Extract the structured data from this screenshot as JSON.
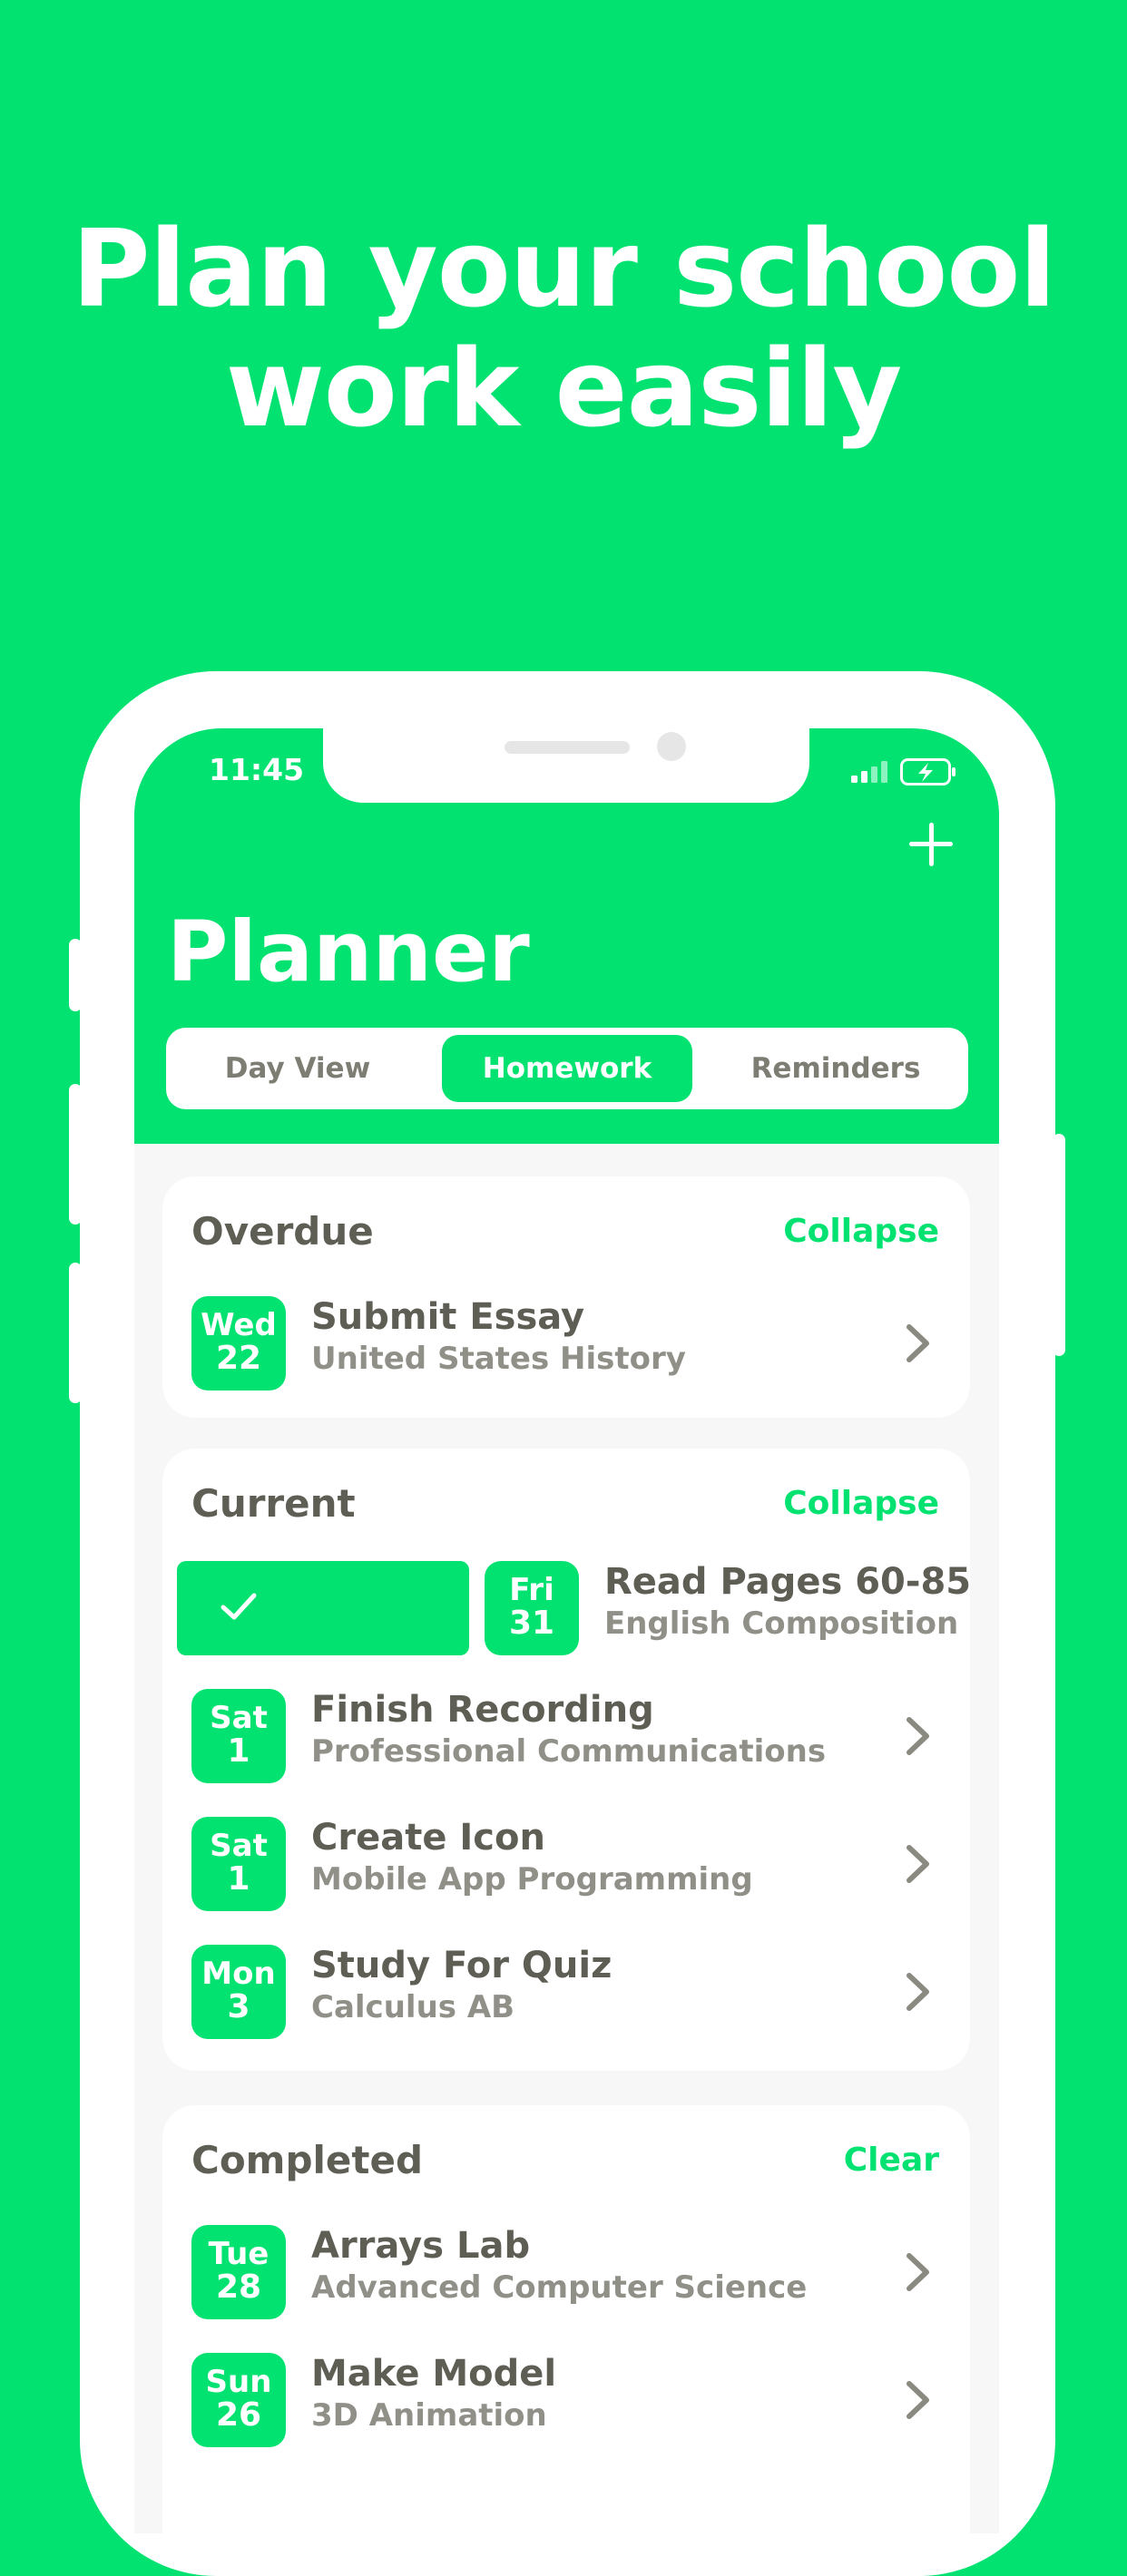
{
  "headline": {
    "line1": "Plan your school",
    "line2": "work easily"
  },
  "status_bar": {
    "time": "11:45"
  },
  "header": {
    "title": "Planner"
  },
  "tabs": [
    {
      "label": "Day View",
      "active": false
    },
    {
      "label": "Homework",
      "active": true
    },
    {
      "label": "Reminders",
      "active": false
    }
  ],
  "sections": {
    "overdue": {
      "title": "Overdue",
      "action": "Collapse",
      "items": [
        {
          "dow": "Wed",
          "day": "22",
          "title": "Submit Essay",
          "subtitle": "United States History"
        }
      ]
    },
    "current": {
      "title": "Current",
      "action": "Collapse",
      "items": [
        {
          "dow": "Fri",
          "day": "31",
          "title": "Read Pages 60-85",
          "subtitle": "English Composition"
        },
        {
          "dow": "Sat",
          "day": "1",
          "title": "Finish Recording",
          "subtitle": "Professional Communications"
        },
        {
          "dow": "Sat",
          "day": "1",
          "title": "Create Icon",
          "subtitle": "Mobile App Programming"
        },
        {
          "dow": "Mon",
          "day": "3",
          "title": "Study For Quiz",
          "subtitle": "Calculus AB"
        }
      ]
    },
    "completed": {
      "title": "Completed",
      "action": "Clear",
      "items": [
        {
          "dow": "Tue",
          "day": "28",
          "title": "Arrays Lab",
          "subtitle": "Advanced Computer Science"
        },
        {
          "dow": "Sun",
          "day": "26",
          "title": "Make Model",
          "subtitle": "3D Animation"
        }
      ]
    }
  },
  "icons": {
    "add": "plus-icon",
    "chevron": "chevron-right-icon",
    "check": "checkmark-icon",
    "signal": "cellular-signal-icon",
    "battery": "battery-charging-icon"
  },
  "colors": {
    "accent": "#02e271",
    "text": "#5e5e55",
    "subtext": "#909088",
    "background": "#f7f7f7"
  }
}
